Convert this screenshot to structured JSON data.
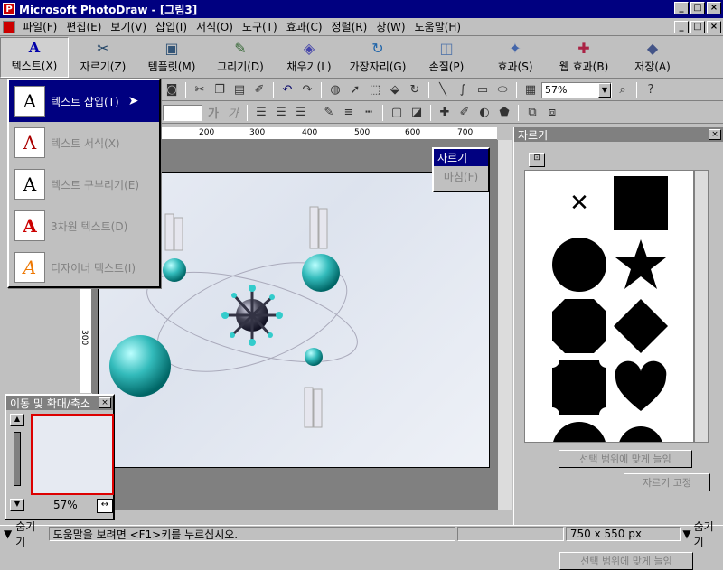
{
  "window": {
    "title": "Microsoft PhotoDraw - [그림3]"
  },
  "menu": [
    "파일(F)",
    "편집(E)",
    "보기(V)",
    "삽입(I)",
    "서식(O)",
    "도구(T)",
    "효과(C)",
    "정렬(R)",
    "창(W)",
    "도움말(H)"
  ],
  "bigbar": [
    {
      "label": "텍스트(X)",
      "icon": "text-icon"
    },
    {
      "label": "자르기(Z)",
      "icon": "scissors-icon"
    },
    {
      "label": "템플릿(M)",
      "icon": "template-icon"
    },
    {
      "label": "그리기(D)",
      "icon": "draw-icon"
    },
    {
      "label": "채우기(L)",
      "icon": "fill-icon"
    },
    {
      "label": "가장자리(G)",
      "icon": "edge-icon"
    },
    {
      "label": "손질(P)",
      "icon": "touchup-icon"
    },
    {
      "label": "효과(S)",
      "icon": "effects-icon"
    },
    {
      "label": "웹 효과(B)",
      "icon": "web-effects-icon"
    },
    {
      "label": "저장(A)",
      "icon": "save-icon"
    }
  ],
  "toolbar": {
    "zoom": "57%"
  },
  "text_menu": [
    {
      "label": "텍스트 삽입(T)",
      "glyph": "A"
    },
    {
      "label": "텍스트 서식(X)",
      "glyph": "A"
    },
    {
      "label": "텍스트 구부리기(E)",
      "glyph": "A"
    },
    {
      "label": "3차원 텍스트(D)",
      "glyph": "A"
    },
    {
      "label": "디자이너 텍스트(I)",
      "glyph": "A"
    }
  ],
  "ruler": {
    "marks": [
      "200",
      "300",
      "400",
      "500",
      "600",
      "700"
    ],
    "vmark": "300"
  },
  "crop_popup": {
    "selected": "자르기",
    "other": "마침(F)"
  },
  "crop_panel": {
    "title": "자르기",
    "btn_fit": "선택 범위에 맞게 늘임",
    "btn_fix": "자르기 고정"
  },
  "nav_panel": {
    "title": "이동 및 확대/축소",
    "zoom": "57%"
  },
  "statusbar": {
    "hide_left": "숨기기",
    "help": "도움말을 보려면 <F1>키를 누르십시오.",
    "size": "750 x 550  px",
    "hide_right": "숨기기"
  }
}
